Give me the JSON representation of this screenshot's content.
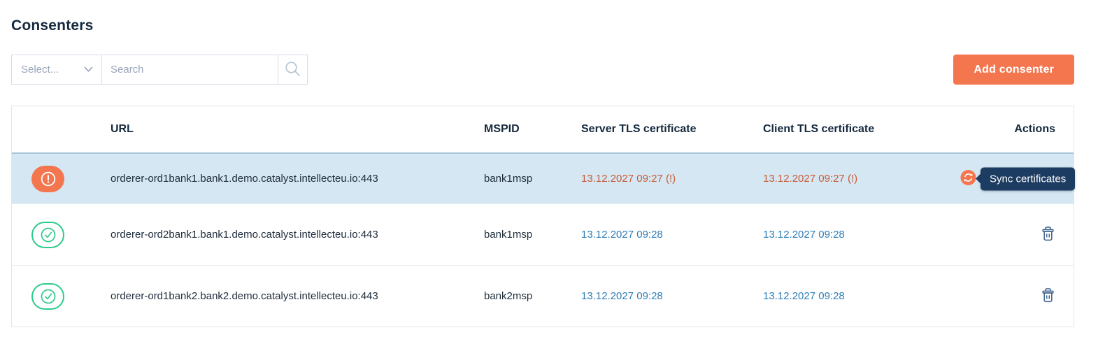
{
  "page": {
    "title": "Consenters"
  },
  "filters": {
    "select_placeholder": "Select...",
    "search_placeholder": "Search"
  },
  "buttons": {
    "add_consenter": "Add consenter"
  },
  "tooltip": {
    "sync_label": "Sync certificates"
  },
  "table": {
    "columns": [
      "URL",
      "MSPID",
      "Server TLS certificate",
      "Client TLS certificate",
      "Actions"
    ],
    "rows": [
      {
        "status": "warning",
        "url": "orderer-ord1bank1.bank1.demo.catalyst.intellecteu.io:443",
        "mspid": "bank1msp",
        "server_cert": "13.12.2027 09:27 (!)",
        "client_cert": "13.12.2027 09:27 (!)",
        "highlighted": true
      },
      {
        "status": "ok",
        "url": "orderer-ord2bank1.bank1.demo.catalyst.intellecteu.io:443",
        "mspid": "bank1msp",
        "server_cert": "13.12.2027 09:28",
        "client_cert": "13.12.2027 09:28",
        "highlighted": false
      },
      {
        "status": "ok",
        "url": "orderer-ord1bank2.bank2.demo.catalyst.intellecteu.io:443",
        "mspid": "bank2msp",
        "server_cert": "13.12.2027 09:28",
        "client_cert": "13.12.2027 09:28",
        "highlighted": false
      }
    ]
  },
  "colors": {
    "accent_orange": "#f4764e",
    "status_green": "#2ecb8a",
    "date_link_blue": "#2e7eb5",
    "date_warning": "#c75c39",
    "tooltip_bg": "#1d3c61",
    "row_highlight": "#d5e7f2",
    "trash_icon": "#3c618c"
  }
}
